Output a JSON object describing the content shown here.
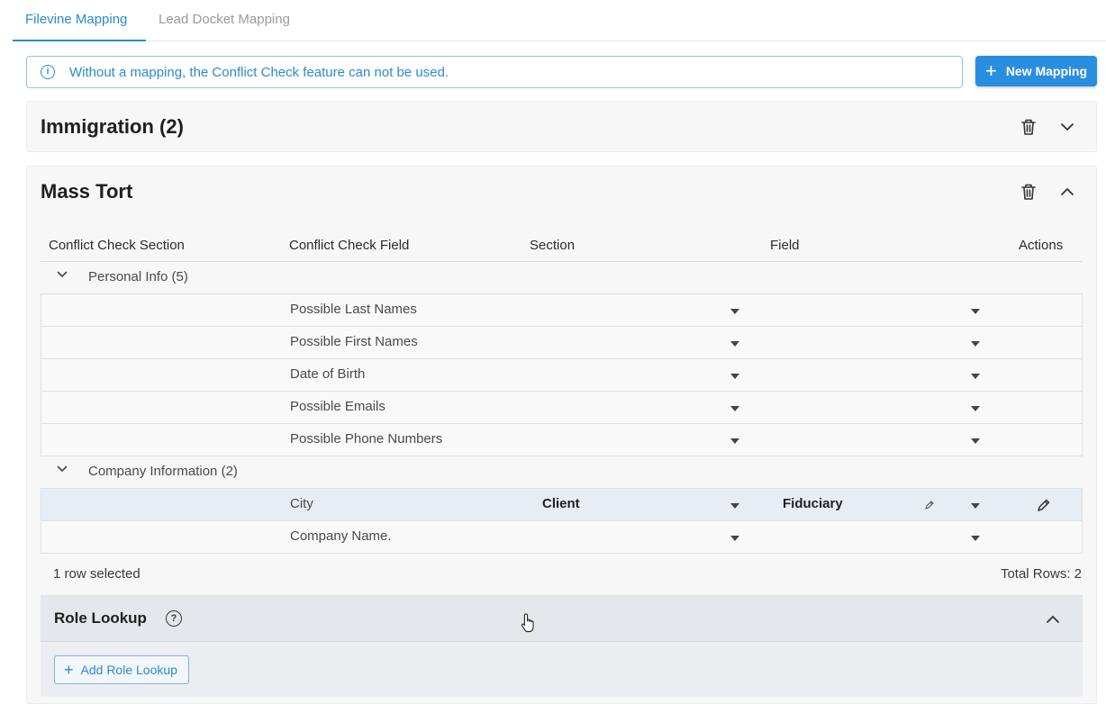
{
  "tabs": [
    {
      "label": "Filevine Mapping",
      "active": true
    },
    {
      "label": "Lead Docket Mapping",
      "active": false
    }
  ],
  "banner": {
    "icon": "info-icon",
    "text": "Without a mapping, the Conflict Check feature can not be used."
  },
  "new_mapping": {
    "icon": "plus-icon",
    "label": "New Mapping"
  },
  "panels": {
    "immigration": {
      "title": "Immigration (2)",
      "expanded": false
    },
    "mass_tort": {
      "title": "Mass Tort",
      "expanded": true
    }
  },
  "table": {
    "columns": [
      "Conflict Check Section",
      "Conflict Check Field",
      "Section",
      "Field",
      "Actions"
    ],
    "groups": [
      {
        "label": "Personal Info (5)",
        "rows": [
          {
            "field": "Possible Last Names",
            "section": "",
            "target": ""
          },
          {
            "field": "Possible First Names",
            "section": "",
            "target": ""
          },
          {
            "field": "Date of Birth",
            "section": "",
            "target": ""
          },
          {
            "field": "Possible Emails",
            "section": "",
            "target": ""
          },
          {
            "field": "Possible Phone Numbers",
            "section": "",
            "target": ""
          }
        ]
      },
      {
        "label": "Company Information (2)",
        "rows": [
          {
            "field": "City",
            "section": "Client",
            "target": "Fiduciary",
            "selected": true
          },
          {
            "field": "Company Name.",
            "section": "",
            "target": ""
          }
        ]
      }
    ],
    "status_selected": "1 row selected",
    "status_total": "Total Rows: 2"
  },
  "role_lookup": {
    "title": "Role Lookup",
    "help_icon": "?",
    "add_label": "Add Role Lookup",
    "expanded": true
  },
  "colors": {
    "accent": "#2a8bd0",
    "button": "#2a8ee0",
    "selected_row": "#e8edf4"
  }
}
